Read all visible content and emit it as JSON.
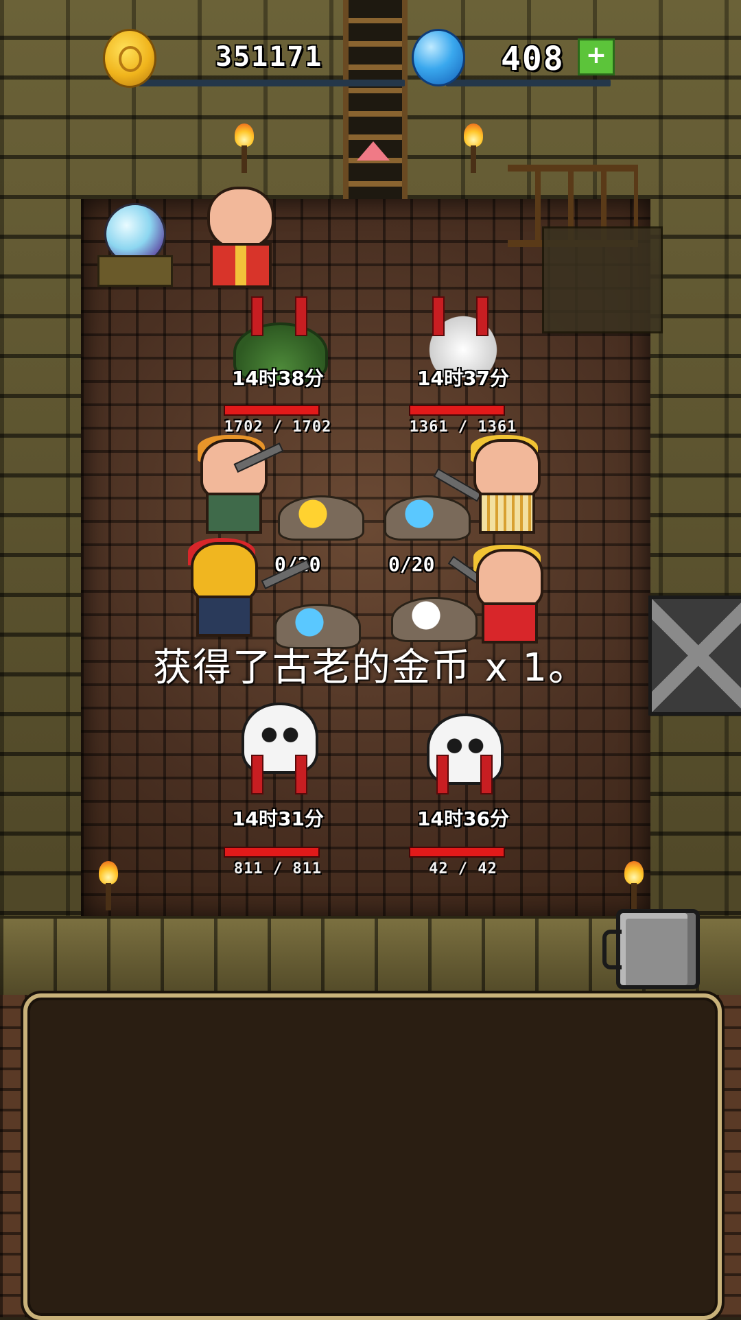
{
  "hud": {
    "gold": {
      "icon": "gold-coin-icon",
      "value": "351171"
    },
    "gems": {
      "icon": "blue-gem-icon",
      "value": "408",
      "add_icon": "plus-icon",
      "add_label": "+"
    }
  },
  "enemies": [
    {
      "name_icon": "slime-icon",
      "timer": "14时38分",
      "hp": "1702 / 1702",
      "hp_fraction": 1.0
    },
    {
      "name_icon": "bones-icon",
      "timer": "14时37分",
      "hp": "1361 / 1361",
      "hp_fraction": 1.0
    },
    {
      "name_icon": "skeleton-sword-icon",
      "timer": "14时31分",
      "hp": "811 / 811",
      "hp_fraction": 1.0
    },
    {
      "name_icon": "skeleton-archer-icon",
      "timer": "14时36分",
      "hp": "42 / 42",
      "hp_fraction": 1.0
    }
  ],
  "mining": {
    "left": {
      "count": "0/20"
    },
    "right": {
      "count": "0/20"
    }
  },
  "notice": "获得了古老的金币 x 1。",
  "colors": {
    "hp_bar": "#e21a1a",
    "gem_add": "#5cc43a",
    "panel_border": "#c9b27a"
  }
}
